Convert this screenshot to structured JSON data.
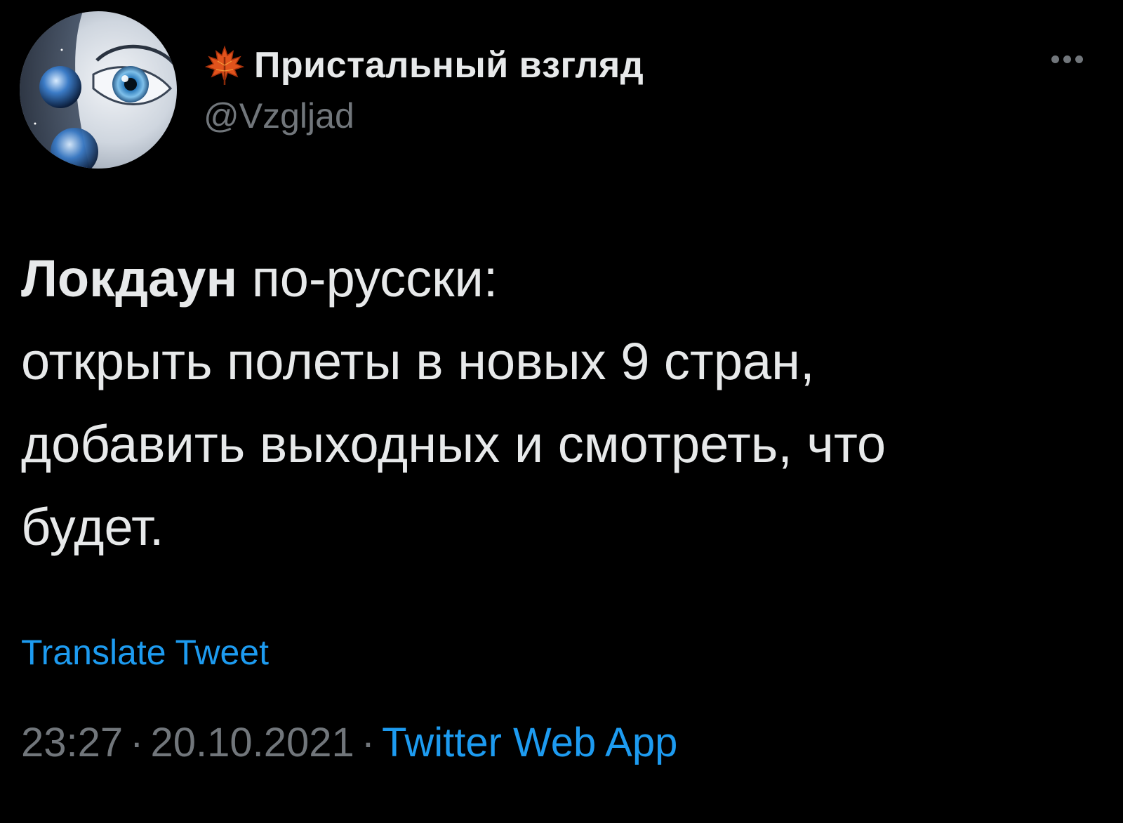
{
  "author": {
    "display_name": "Пристальный взгляд",
    "handle": "@Vzgljad",
    "avatar": "eye-and-planet-avatar",
    "name_emoji": "maple-leaf-icon"
  },
  "menu": {
    "icon": "more-dots-icon"
  },
  "tweet": {
    "line1_bold": "Локдаун",
    "line1_rest": " по-русски:",
    "line2": "открыть полеты в новых 9 стран,",
    "line3": "добавить выходных и смотреть, что",
    "line4": "будет."
  },
  "translate": {
    "label": "Translate Tweet"
  },
  "meta": {
    "time": "23:27",
    "separator": "·",
    "date": "20.10.2021",
    "source": "Twitter Web App"
  },
  "colors": {
    "background": "#000000",
    "text_primary": "#e7e9ea",
    "text_secondary": "#71767b",
    "link": "#1d9bf0"
  }
}
